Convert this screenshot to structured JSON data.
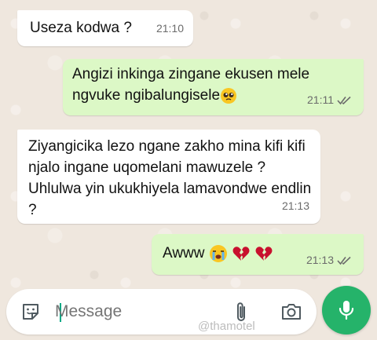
{
  "messages": [
    {
      "direction": "incoming",
      "text": "Useza kodwa ?",
      "time": "21:10"
    },
    {
      "direction": "outgoing",
      "text": "Angizi inkinga zingane ekusen mele ngvuke ngibalungisele",
      "emoji": "pleading-face",
      "time": "21:11",
      "status": "read"
    },
    {
      "direction": "incoming",
      "text": "Ziyangicika lezo ngane zakho mina kifi kifi njalo ingane uqomelani mawuzele ? Uhlulwa yin ukukhiyela lamavondwe endlin ?",
      "time": "21:13"
    },
    {
      "direction": "outgoing",
      "text": "Awww",
      "emoji": "crying-face broken-heart broken-heart",
      "time": "21:13",
      "status": "read"
    }
  ],
  "composer": {
    "placeholder": "Message",
    "watermark": "@thamotel"
  },
  "icons": [
    "sticker-icon",
    "attach-icon",
    "camera-icon",
    "mic-icon",
    "double-check-icon"
  ],
  "colors": {
    "incoming_bubble": "#ffffff",
    "outgoing_bubble": "#dcf8c6",
    "mic_button": "#25b36a",
    "wallpaper": "#efe7de"
  }
}
